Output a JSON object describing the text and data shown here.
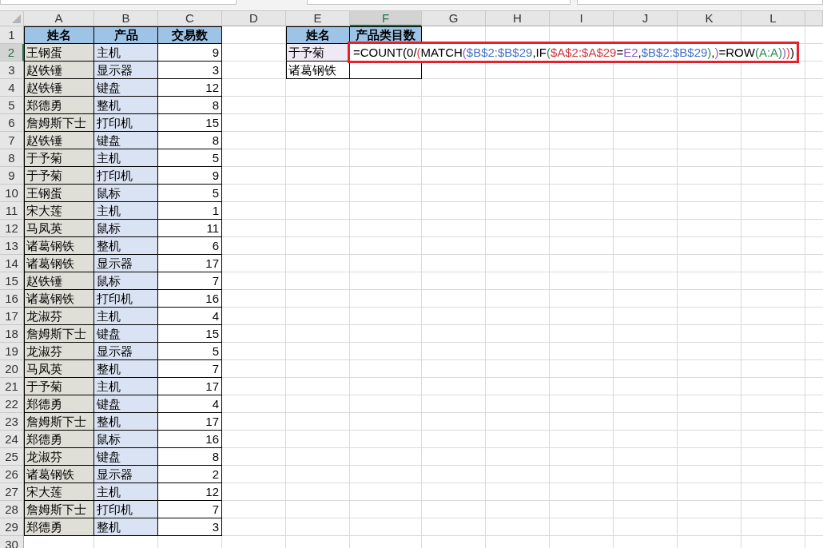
{
  "column_headers": [
    {
      "label": "A",
      "selected": false
    },
    {
      "label": "B",
      "selected": false
    },
    {
      "label": "C",
      "selected": false
    },
    {
      "label": "D",
      "selected": false
    },
    {
      "label": "E",
      "selected": false
    },
    {
      "label": "F",
      "selected": true
    },
    {
      "label": "G",
      "selected": false
    },
    {
      "label": "H",
      "selected": false
    },
    {
      "label": "I",
      "selected": false
    },
    {
      "label": "J",
      "selected": false
    },
    {
      "label": "K",
      "selected": false
    },
    {
      "label": "L",
      "selected": false
    }
  ],
  "row_headers": [
    {
      "label": "1",
      "selected": false
    },
    {
      "label": "2",
      "selected": true
    },
    {
      "label": "3",
      "selected": false
    },
    {
      "label": "4",
      "selected": false
    },
    {
      "label": "5",
      "selected": false
    },
    {
      "label": "6",
      "selected": false
    },
    {
      "label": "7",
      "selected": false
    },
    {
      "label": "8",
      "selected": false
    },
    {
      "label": "9",
      "selected": false
    },
    {
      "label": "10",
      "selected": false
    },
    {
      "label": "11",
      "selected": false
    },
    {
      "label": "12",
      "selected": false
    },
    {
      "label": "13",
      "selected": false
    },
    {
      "label": "14",
      "selected": false
    },
    {
      "label": "15",
      "selected": false
    },
    {
      "label": "16",
      "selected": false
    },
    {
      "label": "17",
      "selected": false
    },
    {
      "label": "18",
      "selected": false
    },
    {
      "label": "19",
      "selected": false
    },
    {
      "label": "20",
      "selected": false
    },
    {
      "label": "21",
      "selected": false
    },
    {
      "label": "22",
      "selected": false
    },
    {
      "label": "23",
      "selected": false
    },
    {
      "label": "24",
      "selected": false
    },
    {
      "label": "25",
      "selected": false
    },
    {
      "label": "26",
      "selected": false
    },
    {
      "label": "27",
      "selected": false
    },
    {
      "label": "28",
      "selected": false
    },
    {
      "label": "29",
      "selected": false
    },
    {
      "label": "30",
      "selected": false
    }
  ],
  "data_table": {
    "columns": [
      {
        "label": "姓名",
        "color": "#e0dfd7"
      },
      {
        "label": "产品",
        "color": "#dae3f3"
      },
      {
        "label": "交易数"
      }
    ],
    "rows": [
      [
        "王钢蛋",
        "主机",
        "9"
      ],
      [
        "赵铁锤",
        "显示器",
        "3"
      ],
      [
        "赵铁锤",
        "键盘",
        "12"
      ],
      [
        "郑德勇",
        "整机",
        "8"
      ],
      [
        "詹姆斯下士",
        "打印机",
        "15"
      ],
      [
        "赵铁锤",
        "键盘",
        "8"
      ],
      [
        "于予菊",
        "主机",
        "5"
      ],
      [
        "于予菊",
        "打印机",
        "9"
      ],
      [
        "王钢蛋",
        "鼠标",
        "5"
      ],
      [
        "宋大莲",
        "主机",
        "1"
      ],
      [
        "马凤英",
        "鼠标",
        "11"
      ],
      [
        "诸葛钢铁",
        "整机",
        "6"
      ],
      [
        "诸葛钢铁",
        "显示器",
        "17"
      ],
      [
        "赵铁锤",
        "鼠标",
        "7"
      ],
      [
        "诸葛钢铁",
        "打印机",
        "16"
      ],
      [
        "龙淑芬",
        "主机",
        "4"
      ],
      [
        "詹姆斯下士",
        "键盘",
        "15"
      ],
      [
        "龙淑芬",
        "显示器",
        "5"
      ],
      [
        "马凤英",
        "整机",
        "7"
      ],
      [
        "于予菊",
        "主机",
        "17"
      ],
      [
        "郑德勇",
        "键盘",
        "4"
      ],
      [
        "詹姆斯下士",
        "整机",
        "17"
      ],
      [
        "郑德勇",
        "鼠标",
        "16"
      ],
      [
        "龙淑芬",
        "键盘",
        "8"
      ],
      [
        "诸葛钢铁",
        "显示器",
        "2"
      ],
      [
        "宋大莲",
        "主机",
        "12"
      ],
      [
        "詹姆斯下士",
        "打印机",
        "7"
      ],
      [
        "郑德勇",
        "整机",
        "3"
      ]
    ]
  },
  "lookup_table": {
    "columns": [
      "姓名",
      "产品类目数"
    ],
    "rows": [
      {
        "name": "于予菊",
        "color": "#efe9f4",
        "editing": true
      },
      {
        "name": "诸葛钢铁",
        "editing": false
      }
    ]
  },
  "formula_tokens": [
    {
      "text": "=COUNT(0/"
    },
    {
      "text": "(",
      "color": "#e0413a"
    },
    {
      "text": "MATCH"
    },
    {
      "text": "(",
      "color": "#9b59b6"
    },
    {
      "text": "$B$2:$B$29",
      "color": "#4472c4"
    },
    {
      "text": ",IF"
    },
    {
      "text": "(",
      "color": "#2e8b57"
    },
    {
      "text": "$A$2:$A$29",
      "color": "#d0393e"
    },
    {
      "text": "="
    },
    {
      "text": "E2",
      "color": "#8e5bc4"
    },
    {
      "text": ","
    },
    {
      "text": "$B$2:$B$29",
      "color": "#4472c4"
    },
    {
      "text": ")",
      "color": "#2e8b57"
    },
    {
      "text": ","
    },
    {
      "text": ")",
      "color": "#9b59b6"
    },
    {
      "text": "=ROW"
    },
    {
      "text": "(A:A)",
      "color": "#2e8b57"
    },
    {
      "text": ")",
      "color": "#9b59b6"
    },
    {
      "text": ")",
      "color": "#e0413a"
    },
    {
      "text": ")"
    }
  ]
}
